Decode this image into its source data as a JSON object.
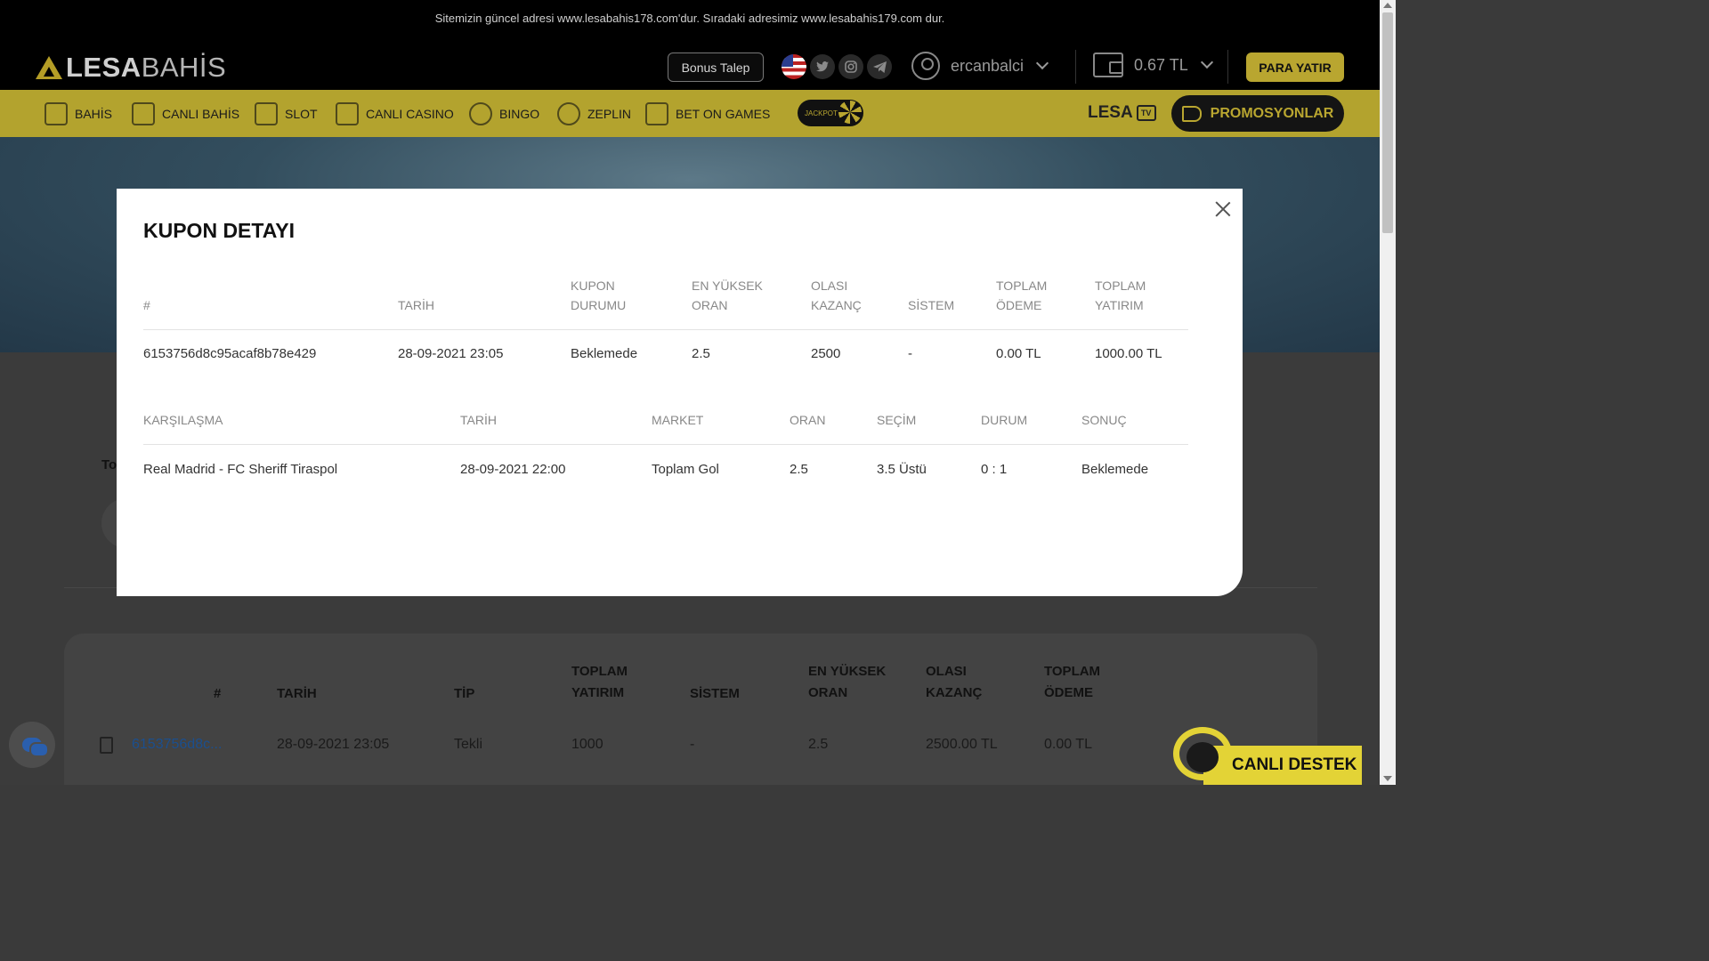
{
  "announcement": "Sitemizin güncel adresi www.lesabahis178.com'dur. Sıradaki adresimiz www.lesabahis179.com dur.",
  "logo": {
    "bold": "LESA",
    "light": "BAHİS"
  },
  "header": {
    "bonus_label": "Bonus Talep",
    "username": "ercanbalci",
    "balance": "0.67 TL",
    "deposit_label": "PARA YATIR"
  },
  "nav": {
    "items": [
      "BAHİS",
      "CANLI BAHİS",
      "SLOT",
      "CANLI CASINO",
      "BINGO",
      "ZEPLIN",
      "BET ON GAMES"
    ],
    "jackpot": "JACKPOT",
    "lesa_tv": "LESA",
    "tv": "TV",
    "promo_label": "PROMOSYONLAR"
  },
  "background": {
    "letter": "To",
    "table_headers": [
      "#",
      "TARİH",
      "TİP",
      "TOPLAM YATIRIM",
      "SİSTEM",
      "EN YÜKSEK ORAN",
      "OLASI KAZANÇ",
      "TOPLAM ÖDEME"
    ],
    "row": [
      "6153756d8c...",
      "28-09-2021 23:05",
      "Tekli",
      "1000",
      "-",
      "2.5",
      "2500.00 TL",
      "0.00 TL"
    ]
  },
  "modal": {
    "title": "KUPON DETAYI",
    "coupon_headers": [
      "#",
      "TARİH",
      "KUPON DURUMU",
      "EN YÜKSEK ORAN",
      "OLASI KAZANÇ",
      "SİSTEM",
      "TOPLAM ÖDEME",
      "TOPLAM YATIRIM"
    ],
    "coupon_row": [
      "6153756d8c95acaf8b78e429",
      "28-09-2021 23:05",
      "Beklemede",
      "2.5",
      "2500",
      "-",
      "0.00 TL",
      "1000.00 TL"
    ],
    "match_headers": [
      "KARŞILAŞMA",
      "TARİH",
      "MARKET",
      "ORAN",
      "SEÇİM",
      "DURUM",
      "SONUÇ"
    ],
    "match_row": [
      "Real Madrid - FC Sheriff Tiraspol",
      "28-09-2021 22:00",
      "Toplam Gol",
      "2.5",
      "3.5 Üstü",
      "0 : 1",
      "Beklemede"
    ]
  },
  "support_label": "CANLI DESTEK"
}
